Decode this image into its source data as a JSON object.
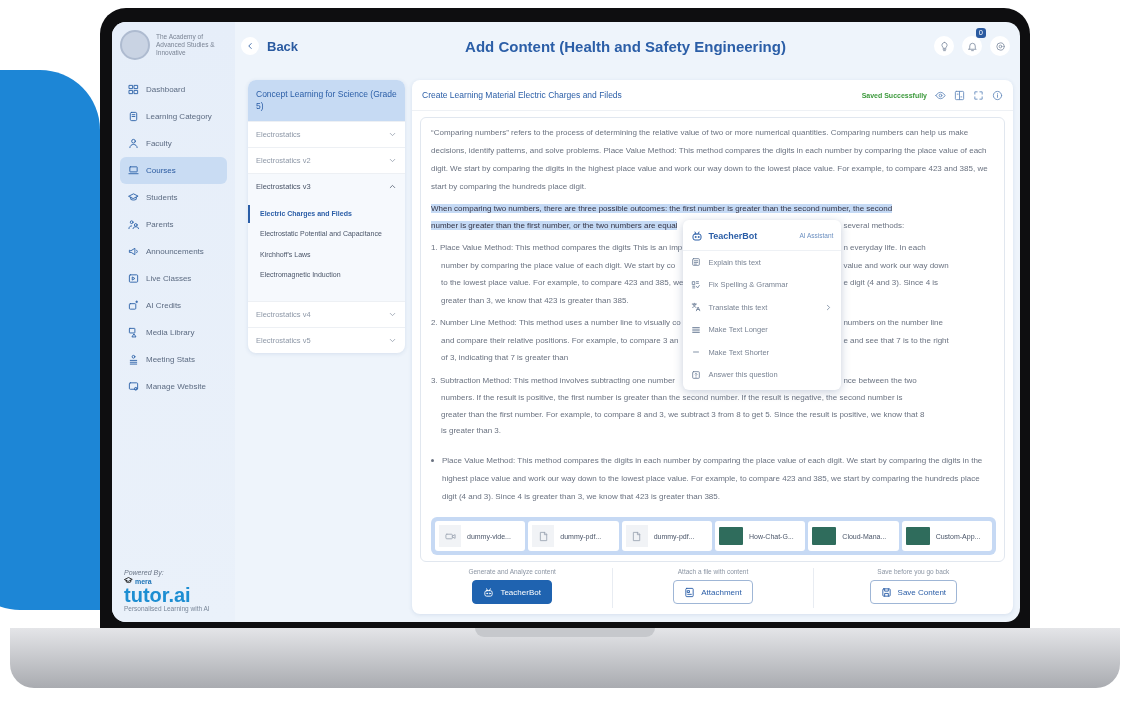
{
  "sidebar": {
    "organization": "The Academy of Advanced Studies & Innovative",
    "items": [
      {
        "label": "Dashboard",
        "selected": false
      },
      {
        "label": "Learning Category",
        "selected": false
      },
      {
        "label": "Faculty",
        "selected": false
      },
      {
        "label": "Courses",
        "selected": true
      },
      {
        "label": "Students",
        "selected": false
      },
      {
        "label": "Parents",
        "selected": false
      },
      {
        "label": "Announcements",
        "selected": false
      },
      {
        "label": "Live Classes",
        "selected": false
      },
      {
        "label": "AI Credits",
        "selected": false
      },
      {
        "label": "Media Library",
        "selected": false
      },
      {
        "label": "Meeting Stats",
        "selected": false
      },
      {
        "label": "Manage Website",
        "selected": false
      }
    ],
    "footer": {
      "caption": "Powered By:",
      "brand_prefix": "mera",
      "brand": "tutor.ai",
      "tagline": "Personalised Learning with AI"
    }
  },
  "header": {
    "back": "Back",
    "title": "Add Content (Health and Safety Engineering)",
    "notification_count": "0"
  },
  "course": {
    "title": "Concept Learning for Science (Grade 5)",
    "chapters": [
      {
        "label": "Electrostatics",
        "expanded": false
      },
      {
        "label": "Electrostatics v2",
        "expanded": false
      },
      {
        "label": "Electrostatics v3",
        "expanded": true,
        "topics": [
          {
            "label": "Electric Charges and Fileds",
            "selected": true
          },
          {
            "label": "Electrostatic Potential and Capacitance",
            "selected": false
          },
          {
            "label": "Kirchhoff's Laws",
            "selected": false
          },
          {
            "label": "Electromagnetic Induction",
            "selected": false
          }
        ]
      },
      {
        "label": "Electrostatics v4",
        "expanded": false
      },
      {
        "label": "Electrostatics v5",
        "expanded": false
      }
    ]
  },
  "editor": {
    "title": "Create Learning Material Electric Charges and Fileds",
    "status": "Saved Successfully",
    "content": [
      {
        "kind": "paragraph",
        "selected": false,
        "text": "“Comparing numbers” refers to the process of determining the relative value of two or more numerical quantities. Comparing numbers can help us make decisions, identify patterns, and solve problems. Place Value Method: This method compares the digits in each number by comparing the place value of each digit. We start by comparing the digits in the highest place value and work our way down to the lowest place value. For example, to compare 423 and 385, we start by comparing the hundreds place digit."
      },
      {
        "kind": "paragraph",
        "selected": true,
        "lines": [
          {
            "text": "When comparing two numbers, there are three possible outcomes: the first number is greater than the second number, the second"
          },
          {
            "text": "number is greater than the first number, or the two numbers are equal",
            "after_menu": "several methods:"
          }
        ]
      },
      {
        "kind": "numbered",
        "selected": false,
        "lines": [
          {
            "text": "1. Place Value Method: This method compares the digits This is an imp",
            "after_menu": "n everyday life. In each"
          },
          {
            "text": "number by comparing the place value of each digit. We start by co",
            "after_menu": "value and work our way down"
          },
          {
            "text": "to the lowest place value. For example, to compare 423 and 385, we",
            "after_menu": "e digit (4 and 3). Since 4 is"
          },
          {
            "text": "greater than 3, we know that 423 is greater than 385."
          }
        ]
      },
      {
        "kind": "numbered",
        "selected": false,
        "lines": [
          {
            "text": "2. Number Line Method: This method uses a number line to visually co",
            "after_menu": "numbers on the number line"
          },
          {
            "text": "and compare their relative positions. For example, to compare 3 an",
            "after_menu": "e and see that 7 is to the right"
          },
          {
            "text": "of 3, indicating that 7 is greater than"
          }
        ]
      },
      {
        "kind": "numbered",
        "selected": false,
        "lines": [
          {
            "text": "3. Subtraction Method: This method involves subtracting one number",
            "after_menu": "nce between the two"
          },
          {
            "text": "numbers. If the result is positive, the first number is greater than the second number. If the result is negative, the second number is"
          },
          {
            "text": "greater than the first number. For example, to compare 8 and 3, we subtract 3 from 8 to get 5. Since the result is positive, we know that 8"
          },
          {
            "text": "is greater than 3."
          }
        ]
      },
      {
        "kind": "bullet",
        "selected": false,
        "text": "Place Value Method: This method compares the digits in each number by comparing the place value of each digit. We start by comparing the digits in the highest place value and work our way down to the lowest place value. For example, to compare 423 and 385, we start by comparing the hundreds place digit (4 and 3). Since 4 is greater than 3, we know that 423 is greater than 385."
      }
    ],
    "menu": {
      "title": "TeacherBot",
      "tag": "AI Assistant",
      "items": [
        {
          "label": "Explain this text",
          "submenu": false
        },
        {
          "label": "Fix Spelling & Grammar",
          "submenu": false
        },
        {
          "label": "Translate this text",
          "submenu": true
        },
        {
          "label": "Make Text Longer",
          "submenu": false
        },
        {
          "label": "Make Text Shorter",
          "submenu": false
        },
        {
          "label": "Answer this question",
          "submenu": false
        }
      ]
    },
    "attachments": [
      {
        "kind": "video",
        "name": "dummy-vide..."
      },
      {
        "kind": "pdf",
        "name": "dummy-pdf..."
      },
      {
        "kind": "pdf",
        "name": "dummy-pdf..."
      },
      {
        "kind": "image",
        "name": "How-Chat-G..."
      },
      {
        "kind": "image",
        "name": "Cloud-Mana..."
      },
      {
        "kind": "image",
        "name": "Custom-App..."
      }
    ],
    "actions": [
      {
        "hint": "Generate and Analyze content",
        "label": "TeacherBot",
        "primary": true
      },
      {
        "hint": "Attach a file with content",
        "label": "Attachment",
        "primary": false
      },
      {
        "hint": "Save before you go back",
        "label": "Save Content",
        "primary": false
      }
    ]
  }
}
